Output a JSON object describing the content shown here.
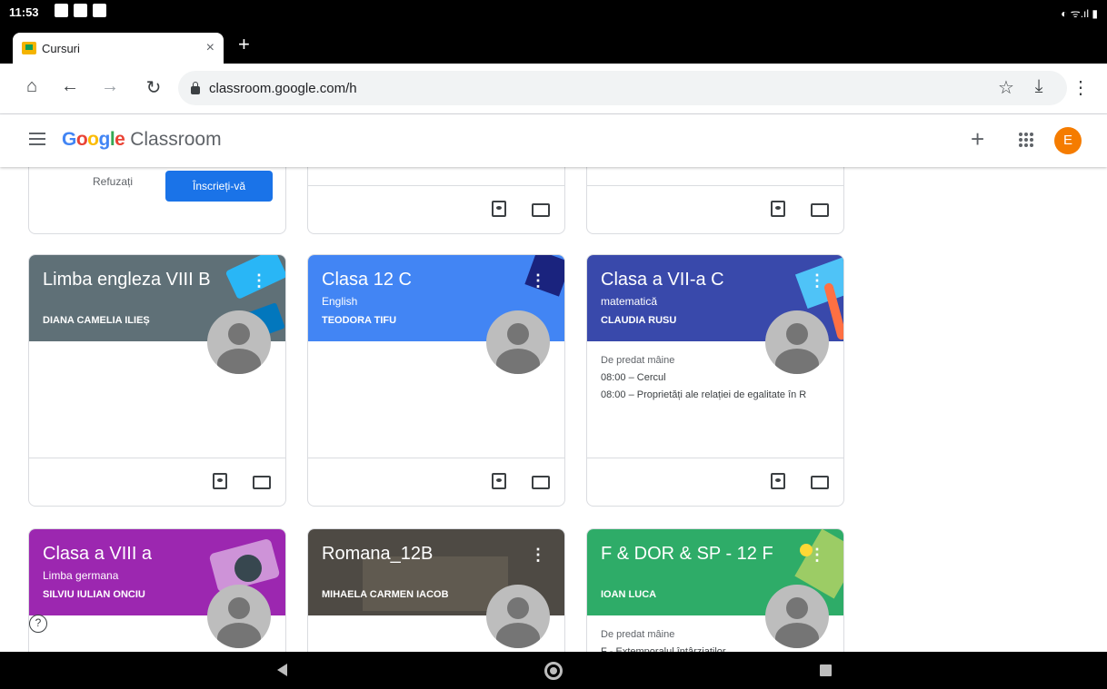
{
  "status_bar": {
    "time": "11:53",
    "right": "◐ ᯤ.ıl ▮"
  },
  "browser": {
    "tab_title": "Cursuri",
    "tab_close": "×",
    "new_tab": "+",
    "url": "classroom.google.com/h",
    "icons": [
      "home-icon",
      "back-icon",
      "forward-icon",
      "reload-icon",
      "star-icon",
      "download-icon",
      "menu-icon"
    ]
  },
  "app": {
    "brand_google": "Google",
    "brand_product": "Classroom",
    "colors": {
      "google_blue": "#4285f4",
      "google_red": "#ea4335",
      "google_yellow": "#fbbc05",
      "google_green": "#34a853"
    },
    "account_initial": "E",
    "account_color": "#f57c00"
  },
  "invite": {
    "decline": "Refuzați",
    "join": "Înscrieți-vă",
    "join_color": "#1a73e8"
  },
  "cards": [
    {
      "title": "Limba engleza VIII B",
      "subtitle": "",
      "teacher": "DIANA CAMELIA ILIEȘ",
      "header_color": "#5f7077"
    },
    {
      "title": "Clasa 12 C",
      "subtitle": "English",
      "teacher": "TEODORA TIFU",
      "header_color": "#4285f4"
    },
    {
      "title": "Clasa a VII-a C",
      "subtitle": "matematică",
      "teacher": "CLAUDIA RUSU",
      "header_color": "#3949ab",
      "upcoming_label": "De predat mâine",
      "upcoming": [
        "08:00 – Cercul",
        "08:00 – Proprietăți ale relației de egalitate în R"
      ]
    },
    {
      "title": "Clasa a VIII a",
      "subtitle": "Limba germana",
      "teacher": "SILVIU IULIAN ONCIU",
      "header_color": "#9c27b0"
    },
    {
      "title": "Romana_12B",
      "subtitle": "",
      "teacher": "MIHAELA CARMEN IACOB",
      "header_color": "#4e4a44"
    },
    {
      "title": "F & DOR & SP - 12 F",
      "subtitle": "",
      "teacher": "IOAN LUCA",
      "header_color": "#2eac68",
      "upcoming_label": "De predat mâine",
      "upcoming": [
        "F - Extemporalul întârziaților"
      ]
    }
  ],
  "help": "?"
}
